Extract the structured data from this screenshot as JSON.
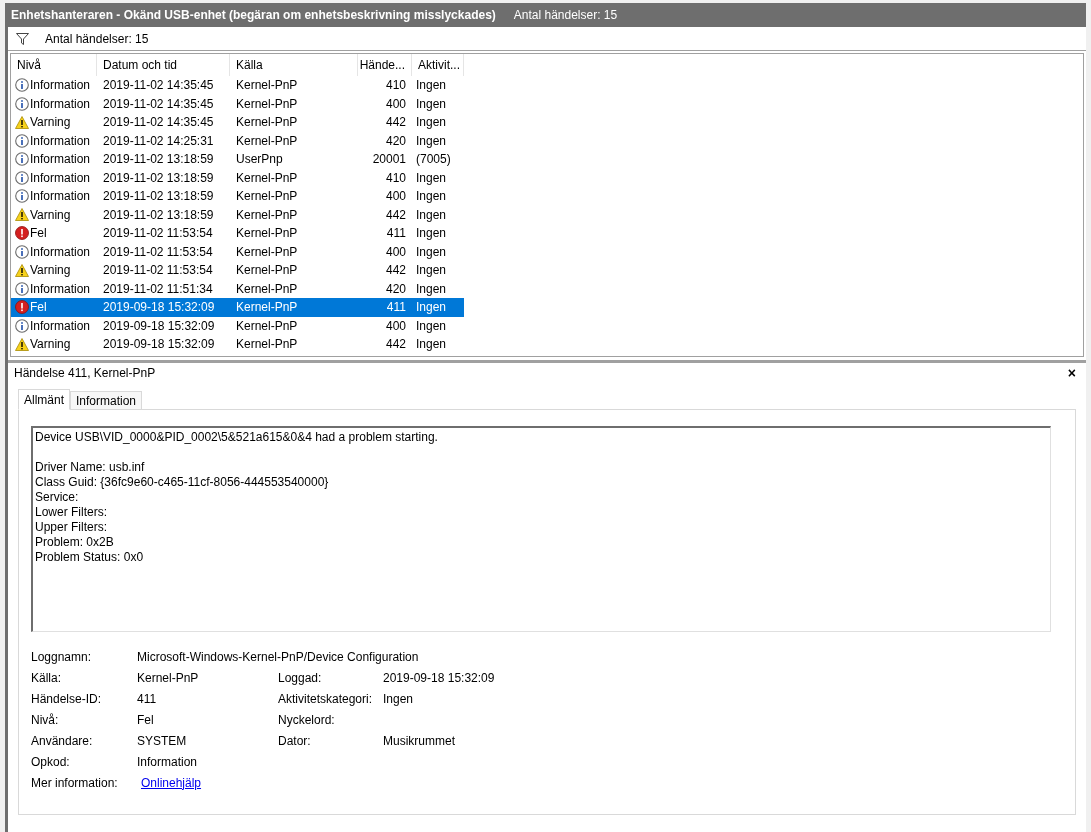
{
  "title_bar": {
    "title": "Enhetshanteraren - Okänd USB-enhet (begäran om enhetsbeskrivning misslyckades)",
    "count": "Antal händelser: 15"
  },
  "filter_bar": {
    "text": "Antal händelser: 15"
  },
  "table": {
    "columns": [
      "Nivå",
      "Datum och tid",
      "Källa",
      "Hände...",
      "Aktivit..."
    ],
    "rows": [
      {
        "kind": "info",
        "level": "Information",
        "date": "2019-11-02 14:35:45",
        "source": "Kernel-PnP",
        "id": "410",
        "task": "Ingen",
        "selected": false
      },
      {
        "kind": "info",
        "level": "Information",
        "date": "2019-11-02 14:35:45",
        "source": "Kernel-PnP",
        "id": "400",
        "task": "Ingen",
        "selected": false
      },
      {
        "kind": "warning",
        "level": "Varning",
        "date": "2019-11-02 14:35:45",
        "source": "Kernel-PnP",
        "id": "442",
        "task": "Ingen",
        "selected": false
      },
      {
        "kind": "info",
        "level": "Information",
        "date": "2019-11-02 14:25:31",
        "source": "Kernel-PnP",
        "id": "420",
        "task": "Ingen",
        "selected": false
      },
      {
        "kind": "info",
        "level": "Information",
        "date": "2019-11-02 13:18:59",
        "source": "UserPnp",
        "id": "20001",
        "task": "(7005)",
        "selected": false
      },
      {
        "kind": "info",
        "level": "Information",
        "date": "2019-11-02 13:18:59",
        "source": "Kernel-PnP",
        "id": "410",
        "task": "Ingen",
        "selected": false
      },
      {
        "kind": "info",
        "level": "Information",
        "date": "2019-11-02 13:18:59",
        "source": "Kernel-PnP",
        "id": "400",
        "task": "Ingen",
        "selected": false
      },
      {
        "kind": "warning",
        "level": "Varning",
        "date": "2019-11-02 13:18:59",
        "source": "Kernel-PnP",
        "id": "442",
        "task": "Ingen",
        "selected": false
      },
      {
        "kind": "error",
        "level": "Fel",
        "date": "2019-11-02 11:53:54",
        "source": "Kernel-PnP",
        "id": "411",
        "task": "Ingen",
        "selected": false
      },
      {
        "kind": "info",
        "level": "Information",
        "date": "2019-11-02 11:53:54",
        "source": "Kernel-PnP",
        "id": "400",
        "task": "Ingen",
        "selected": false
      },
      {
        "kind": "warning",
        "level": "Varning",
        "date": "2019-11-02 11:53:54",
        "source": "Kernel-PnP",
        "id": "442",
        "task": "Ingen",
        "selected": false
      },
      {
        "kind": "info",
        "level": "Information",
        "date": "2019-11-02 11:51:34",
        "source": "Kernel-PnP",
        "id": "420",
        "task": "Ingen",
        "selected": false
      },
      {
        "kind": "error",
        "level": "Fel",
        "date": "2019-09-18 15:32:09",
        "source": "Kernel-PnP",
        "id": "411",
        "task": "Ingen",
        "selected": true
      },
      {
        "kind": "info",
        "level": "Information",
        "date": "2019-09-18 15:32:09",
        "source": "Kernel-PnP",
        "id": "400",
        "task": "Ingen",
        "selected": false
      },
      {
        "kind": "warning",
        "level": "Varning",
        "date": "2019-09-18 15:32:09",
        "source": "Kernel-PnP",
        "id": "442",
        "task": "Ingen",
        "selected": false
      }
    ]
  },
  "details": {
    "title": "Händelse 411, Kernel-PnP",
    "close": "×",
    "tabs": [
      {
        "label": "Allmänt",
        "selected": true
      },
      {
        "label": "Information",
        "selected": false
      }
    ],
    "message": {
      "first": "Device USB\\VID_0000&PID_0002\\5&521a615&0&4 had a problem starting.",
      "lines": [
        "Driver Name: usb.inf",
        "Class Guid: {36fc9e60-c465-11cf-8056-444553540000}",
        "Service:",
        "Lower Filters:",
        "Upper Filters:",
        "Problem: 0x2B",
        "Problem Status: 0x0"
      ]
    },
    "properties": [
      {
        "left": {
          "label": "Loggnamn:",
          "value": "Microsoft-Windows-Kernel-PnP/Device Configuration",
          "kind": "text"
        }
      },
      {
        "left": {
          "label": "Källa:",
          "value": "Kernel-PnP",
          "kind": "text"
        },
        "right": {
          "label": "Loggad:",
          "value": "2019-09-18 15:32:09"
        }
      },
      {
        "left": {
          "label": "Händelse-ID:",
          "value": "411",
          "kind": "text"
        },
        "right": {
          "label": "Aktivitetskategori:",
          "value": "Ingen"
        }
      },
      {
        "left": {
          "label": "Nivå:",
          "value": "Fel",
          "kind": "text"
        },
        "right": {
          "label": "Nyckelord:"
        }
      },
      {
        "left": {
          "label": "Användare:",
          "value": "SYSTEM",
          "kind": "text"
        },
        "right": {
          "label": "Dator:",
          "value": "Musikrummet"
        }
      },
      {
        "left": {
          "label": "Opkod:",
          "value": "Information",
          "kind": "text"
        }
      },
      {
        "left": {
          "label": "Mer information:",
          "value": "Onlinehjälp",
          "kind": "link"
        }
      }
    ]
  }
}
